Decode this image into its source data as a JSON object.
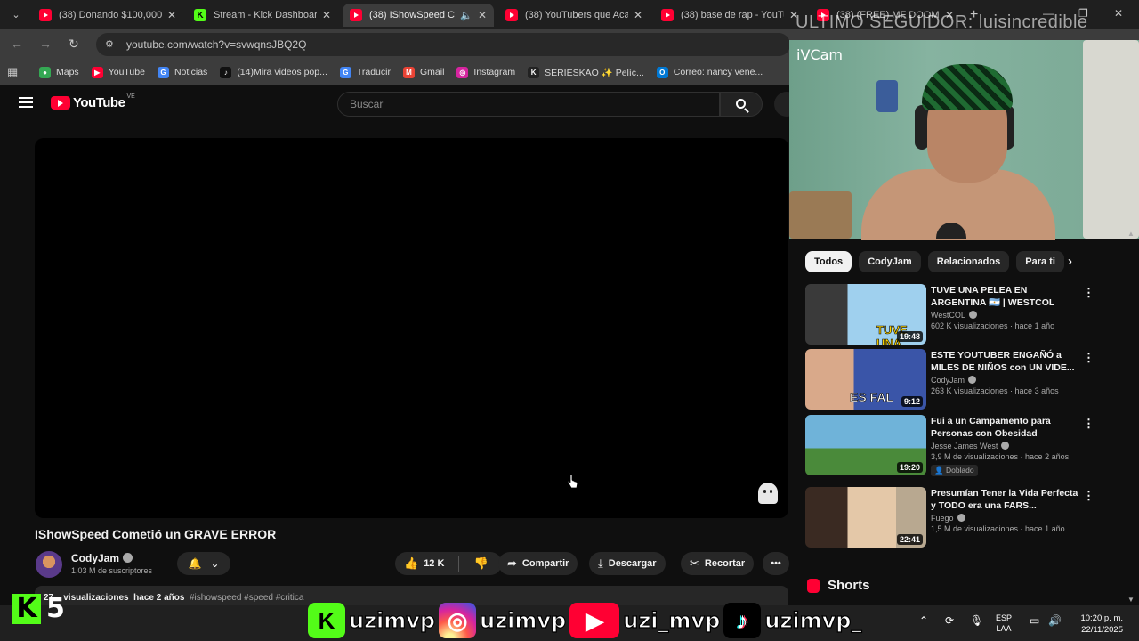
{
  "browser": {
    "tabs": [
      {
        "title": "(38) Donando $100,000",
        "favicon": "youtube"
      },
      {
        "title": "Stream - Kick Dashboar",
        "favicon": "kick"
      },
      {
        "title": "(38) IShowSpeed Co",
        "favicon": "youtube",
        "active": true
      },
      {
        "title": "(38) YouTubers que Aca",
        "favicon": "youtube"
      },
      {
        "title": "(38) base de rap - YouTu",
        "favicon": "youtube"
      },
      {
        "title": "(38) (FREE) MF DOOM",
        "favicon": "youtube"
      }
    ],
    "new_tab": "+",
    "url": "youtube.com/watch?v=svwqnsJBQ2Q",
    "bookmarks": [
      {
        "label": "Maps",
        "color": "#34a853",
        "glyph": "●"
      },
      {
        "label": "YouTube",
        "color": "#ff0033",
        "glyph": "▶"
      },
      {
        "label": "Noticias",
        "color": "#4285f4",
        "glyph": "G"
      },
      {
        "label": "(14)Mira videos pop...",
        "color": "#111111",
        "glyph": "♪"
      },
      {
        "label": "Traducir",
        "color": "#4285f4",
        "glyph": "G"
      },
      {
        "label": "Gmail",
        "color": "#ea4335",
        "glyph": "M"
      },
      {
        "label": "Instagram",
        "color": "#d6249f",
        "glyph": "◎"
      },
      {
        "label": "SERIESKAO ✨ Pelíc...",
        "color": "#222222",
        "glyph": "K"
      },
      {
        "label": "Correo: nancy vene...",
        "color": "#0078d4",
        "glyph": "O"
      }
    ]
  },
  "youtube": {
    "logo_text": "YouTube",
    "region": "VE",
    "search_placeholder": "Buscar",
    "video_title": "IShowSpeed Cometió un GRAVE ERROR",
    "channel": {
      "name": "CodyJam",
      "subscribers": "1,03 M de suscriptores"
    },
    "actions": {
      "likes": "12 K",
      "share": "Compartir",
      "download": "Descargar",
      "clip": "Recortar",
      "more": "•••"
    },
    "description_meta": {
      "views": "27... visualizaciones",
      "age": "hace 2 años",
      "tags": "#ishowspeed #speed #critica"
    },
    "chips": [
      "Todos",
      "CodyJam",
      "Relacionados",
      "Para ti"
    ],
    "recommendations": [
      {
        "title": "TUVE UNA PELEA EN ARGENTINA 🇦🇷 | WESTCOL",
        "channel": "WestCOL",
        "meta": "602 K visualizaciones · hace 1 año",
        "duration": "19:48",
        "thumb_overlay": "TUVE UNA PEL"
      },
      {
        "title": "ESTE YOUTUBER ENGAÑÓ a MILES DE NIÑOS con UN VIDE...",
        "channel": "CodyJam",
        "meta": "263 K visualizaciones · hace 3 años",
        "duration": "9:12",
        "thumb_overlay": "ES FAL"
      },
      {
        "title": "Fui a un Campamento para Personas con Obesidad",
        "channel": "Jesse James West",
        "meta": "3,9 M de visualizaciones · hace 2 años",
        "duration": "19:20",
        "badge": "Doblado"
      },
      {
        "title": "Presumían Tener la Vida Perfecta y TODO era una FARS...",
        "channel": "Fuego",
        "meta": "1,5 M de visualizaciones · hace 1 año",
        "duration": "22:41"
      }
    ],
    "shorts_label": "Shorts"
  },
  "overlay": {
    "webcam_label": "iVCam",
    "top_text": "ULTIMO SEGUIDOR: luisincredible",
    "kick_count": "5",
    "kick_letter": "K",
    "socials": [
      {
        "platform": "kick",
        "handle": "uzimvp"
      },
      {
        "platform": "instagram",
        "handle": "uzimvp"
      },
      {
        "platform": "youtube",
        "handle": "uzi_mvp"
      },
      {
        "platform": "tiktok",
        "handle": "uzimvp_"
      }
    ]
  },
  "taskbar": {
    "lang": "ESP",
    "lang_sub": "LAA",
    "time": "10:20 p. m.",
    "date": "22/11/2025"
  },
  "colors": {
    "youtube_red": "#ff0033",
    "kick_green": "#53fc18",
    "bg": "#0f0f0f"
  }
}
